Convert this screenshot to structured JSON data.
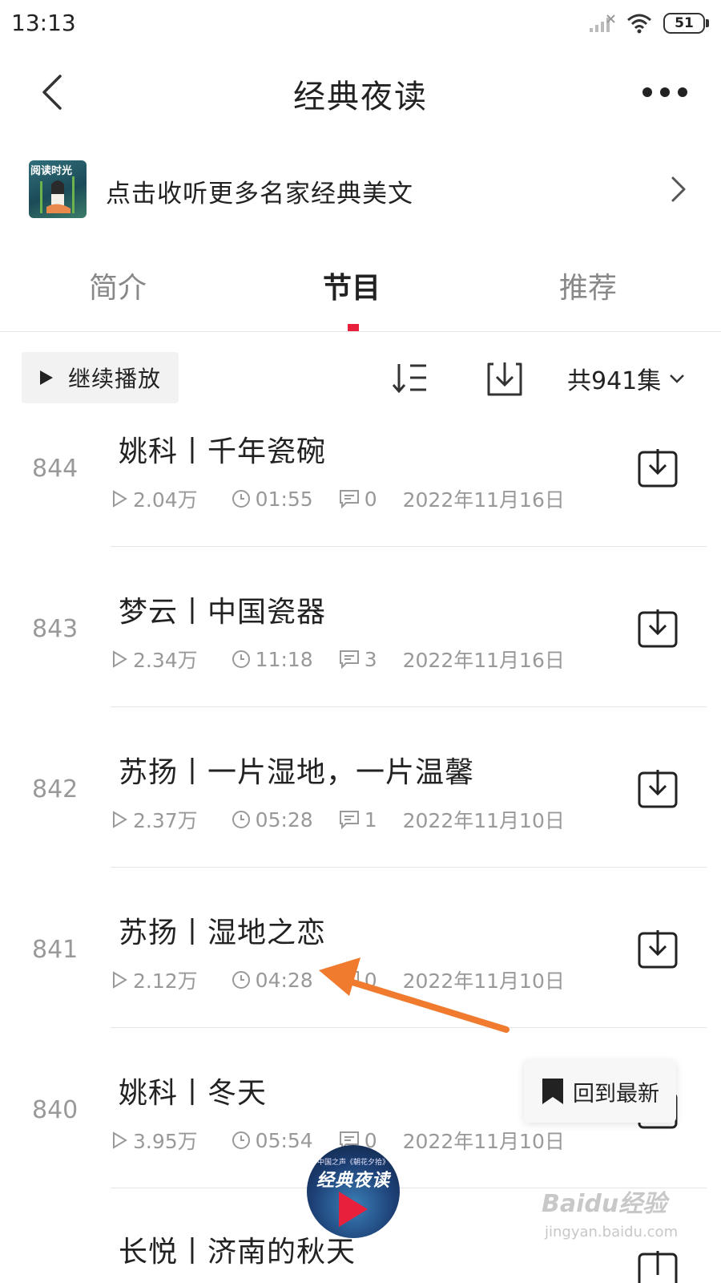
{
  "status_bar": {
    "time": "13:13",
    "battery": "51"
  },
  "header": {
    "title": "经典夜读"
  },
  "promo": {
    "thumb_text": "阅读时光",
    "text": "点击收听更多名家经典美文"
  },
  "tabs": [
    {
      "label": "简介"
    },
    {
      "label": "节目",
      "active": true
    },
    {
      "label": "推荐"
    }
  ],
  "toolbar": {
    "continue_label": "继续播放",
    "count_label": "共941集"
  },
  "episodes": [
    {
      "num": "844",
      "title": "姚科丨千年瓷碗",
      "plays": "2.04万",
      "duration": "01:55",
      "comments": "0",
      "date": "2022年11月16日"
    },
    {
      "num": "843",
      "title": "梦云丨中国瓷器",
      "plays": "2.34万",
      "duration": "11:18",
      "comments": "3",
      "date": "2022年11月16日"
    },
    {
      "num": "842",
      "title": "苏扬丨一片湿地，一片温馨",
      "plays": "2.37万",
      "duration": "05:28",
      "comments": "1",
      "date": "2022年11月10日"
    },
    {
      "num": "841",
      "title": "苏扬丨湿地之恋",
      "plays": "2.12万",
      "duration": "04:28",
      "comments": "0",
      "date": "2022年11月10日"
    },
    {
      "num": "840",
      "title": "姚科丨冬天",
      "plays": "3.95万",
      "duration": "05:54",
      "comments": "0",
      "date": "2022年11月10日"
    },
    {
      "num": "",
      "title": "长悦丨济南的秋天",
      "plays": "",
      "duration": "",
      "comments": "",
      "date": ""
    }
  ],
  "back_to_latest": {
    "label": "回到最新"
  },
  "player": {
    "small_text": "中国之声《朝花夕拾》",
    "title": "经典夜读"
  },
  "watermark": {
    "main": "Baidu经验",
    "sub": "jingyan.baidu.com"
  },
  "colors": {
    "accent": "#e8203b",
    "annotation_arrow": "#f07a2e"
  }
}
